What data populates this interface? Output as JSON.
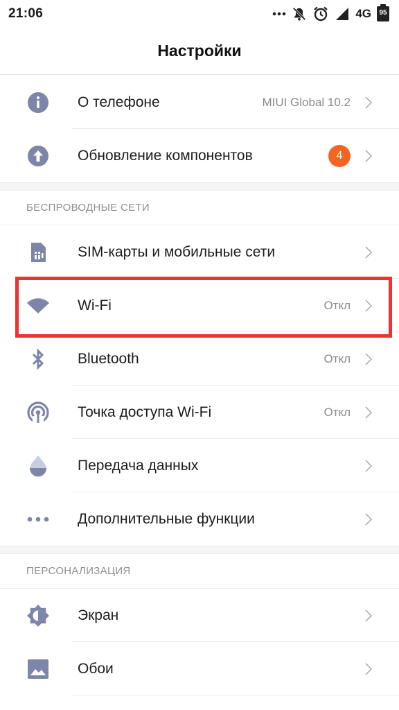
{
  "status_bar": {
    "time": "21:06",
    "network": "4G",
    "battery": "95",
    "icons": [
      "more-dots-icon",
      "notifications-off-icon",
      "alarm-icon",
      "signal-icon",
      "battery-icon"
    ]
  },
  "header": {
    "title": "Настройки"
  },
  "colors": {
    "icon": "#7d86a8",
    "badge": "#f26522",
    "highlight": "#ee3333"
  },
  "groups": [
    {
      "items": [
        {
          "label": "О телефоне",
          "value": "MIUI Global 10.2",
          "icon": "info-icon"
        },
        {
          "label": "Обновление компонентов",
          "badge": "4",
          "icon": "update-icon"
        }
      ]
    },
    {
      "title": "БЕСПРОВОДНЫЕ СЕТИ",
      "items": [
        {
          "label": "SIM-карты и мобильные сети",
          "icon": "sim-card-icon"
        },
        {
          "label": "Wi-Fi",
          "value": "Откл",
          "icon": "wifi-icon",
          "highlighted": true
        },
        {
          "label": "Bluetooth",
          "value": "Откл",
          "icon": "bluetooth-icon"
        },
        {
          "label": "Точка доступа Wi-Fi",
          "value": "Откл",
          "icon": "hotspot-icon"
        },
        {
          "label": "Передача данных",
          "icon": "data-usage-icon"
        },
        {
          "label": "Дополнительные функции",
          "icon": "more-icon"
        }
      ]
    },
    {
      "title": "ПЕРСОНАЛИЗАЦИЯ",
      "items": [
        {
          "label": "Экран",
          "icon": "display-icon"
        },
        {
          "label": "Обои",
          "icon": "wallpaper-icon"
        }
      ]
    }
  ]
}
